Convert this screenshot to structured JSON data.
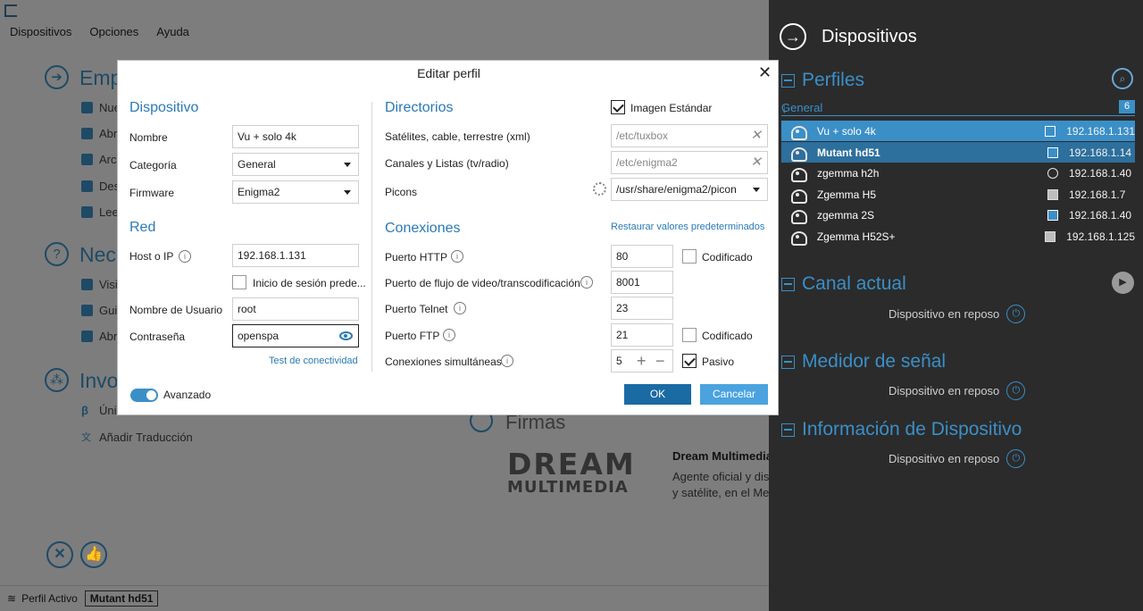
{
  "menubar": {
    "items": [
      "Dispositivos",
      "Opciones",
      "Ayuda"
    ]
  },
  "background": {
    "sections": [
      {
        "title": "Emp",
        "items": [
          "Nue",
          "Abr",
          "Arc",
          "Des",
          "Lee"
        ]
      },
      {
        "title": "Nece",
        "items": [
          "Visi",
          "Gui",
          "Abr"
        ]
      },
      {
        "title": "Invo",
        "items": [
          "Úni",
          "Añadir Traducción"
        ]
      }
    ],
    "firmas": {
      "title": "Firmas",
      "logo_line1": "DREAM",
      "logo_line2": "MULTIMEDIA",
      "name": "Dream Multimedia",
      "desc_line1": "Agente oficial y dis",
      "desc_line2": "y satélite, en el Me"
    }
  },
  "statusbar": {
    "label": "Perfil Activo",
    "value": "Mutant hd51"
  },
  "panel": {
    "title": "Dispositivos",
    "perfiles": "Perfiles",
    "group_label": "General",
    "group_count": "6",
    "devices": [
      {
        "name": "Vu + solo 4k",
        "ip": "192.168.1.131"
      },
      {
        "name": "Mutant hd51",
        "ip": "192.168.1.14"
      },
      {
        "name": "zgemma h2h",
        "ip": "192.168.1.40"
      },
      {
        "name": "Zgemma H5",
        "ip": "192.168.1.7"
      },
      {
        "name": "zgemma 2S",
        "ip": "192.168.1.40"
      },
      {
        "name": "Zgemma H52S+",
        "ip": "192.168.1.125"
      }
    ],
    "canal_actual": "Canal actual",
    "medidor": "Medidor de señal",
    "informacion": "Información de Dispositivo",
    "standby_text": "Dispositivo en reposo"
  },
  "dialog": {
    "title": "Editar perfil",
    "dispositivo": {
      "heading": "Dispositivo",
      "nombre_label": "Nombre",
      "nombre_value": "Vu + solo 4k",
      "categoria_label": "Categoría",
      "categoria_value": "General",
      "firmware_label": "Firmware",
      "firmware_value": "Enigma2"
    },
    "red": {
      "heading": "Red",
      "host_label": "Host o IP",
      "host_value": "192.168.1.131",
      "login_default_label": "Inicio de sesión prede...",
      "user_label": "Nombre de Usuario",
      "user_value": "root",
      "pass_label": "Contraseña",
      "pass_value": "openspa",
      "test_link": "Test de conectividad"
    },
    "directorios": {
      "heading": "Directorios",
      "imagen_estandar": "Imagen Estándar",
      "satelites_label": "Satélites, cable, terrestre (xml)",
      "satelites_value": "/etc/tuxbox",
      "canales_label": "Canales y Listas (tv/radio)",
      "canales_value": "/etc/enigma2",
      "picons_label": "Picons",
      "picons_value": "/usr/share/enigma2/picon"
    },
    "conexiones": {
      "heading": "Conexiones",
      "restore_link": "Restaurar valores predeterminados",
      "http_label": "Puerto HTTP",
      "http_value": "80",
      "codificado": "Codificado",
      "stream_label": "Puerto de flujo de video/transcodificación",
      "stream_value": "8001",
      "telnet_label": "Puerto Telnet",
      "telnet_value": "23",
      "ftp_label": "Puerto FTP",
      "ftp_value": "21",
      "simult_label": "Conexiones simultáneas",
      "simult_value": "5",
      "pasivo": "Pasivo"
    },
    "avanzado": "Avanzado",
    "ok": "OK",
    "cancel": "Cancelar"
  }
}
